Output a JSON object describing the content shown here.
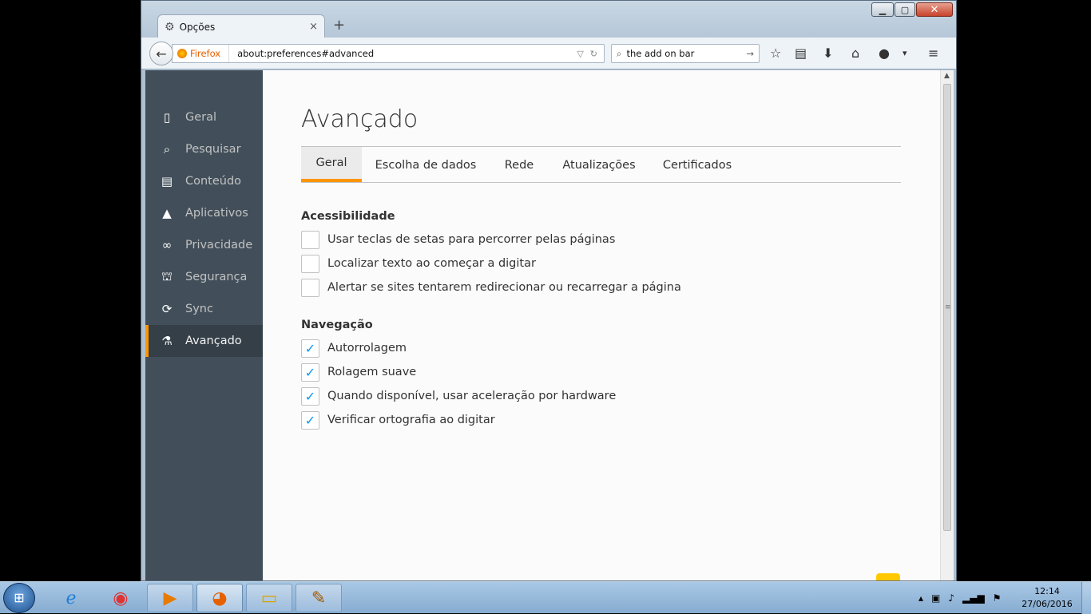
{
  "window": {
    "tab_title": "Opções",
    "new_tab": "+",
    "tab_close": "×",
    "min": "▁",
    "max": "▢",
    "close": "✕"
  },
  "navbar": {
    "identity": "Firefox",
    "url": "about:preferences#advanced",
    "search_query": "the add on bar"
  },
  "sidebar": {
    "items": [
      {
        "label": "Geral",
        "icon": "general-icon"
      },
      {
        "label": "Pesquisar",
        "icon": "search-icon"
      },
      {
        "label": "Conteúdo",
        "icon": "content-icon"
      },
      {
        "label": "Aplicativos",
        "icon": "applications-icon"
      },
      {
        "label": "Privacidade",
        "icon": "privacy-mask-icon"
      },
      {
        "label": "Segurança",
        "icon": "security-icon"
      },
      {
        "label": "Sync",
        "icon": "sync-icon"
      },
      {
        "label": "Avançado",
        "icon": "advanced-icon"
      }
    ],
    "selected": "Avançado"
  },
  "main": {
    "title": "Avançado",
    "tabs": [
      "Geral",
      "Escolha de dados",
      "Rede",
      "Atualizações",
      "Certificados"
    ],
    "selected_tab": "Geral",
    "accessibility": {
      "heading": "Acessibilidade",
      "options": [
        {
          "label": "Usar teclas de setas para percorrer pelas páginas",
          "checked": false
        },
        {
          "label": "Localizar texto ao começar a digitar",
          "checked": false
        },
        {
          "label": "Alertar se sites tentarem redirecionar ou recarregar a página",
          "checked": false
        }
      ]
    },
    "navigation": {
      "heading": "Navegação",
      "options": [
        {
          "label": "Autorrolagem",
          "checked": true
        },
        {
          "label": "Rolagem suave",
          "checked": true
        },
        {
          "label": "Quando disponível, usar aceleração por hardware",
          "checked": true
        },
        {
          "label": "Verificar ortografia ao digitar",
          "checked": true
        }
      ]
    }
  },
  "taskbar": {
    "time": "12:14",
    "date": "27/06/2016",
    "apps": [
      "Internet Explorer",
      "Google Chrome",
      "Media Player",
      "Firefox",
      "Windows Explorer",
      "Paint"
    ]
  },
  "colors": {
    "accent": "#ff9500",
    "sidebar": "#424f5a",
    "sidebar_selected": "#343f48",
    "checkbox_check": "#0996f8"
  }
}
